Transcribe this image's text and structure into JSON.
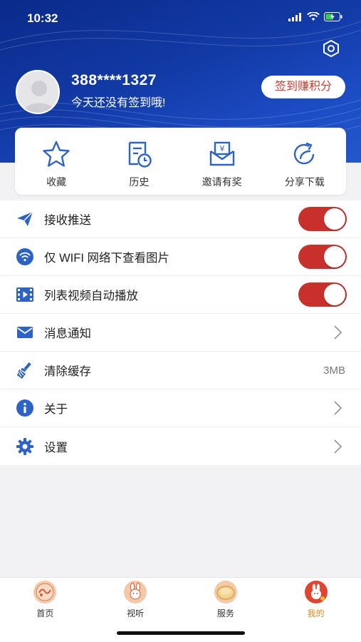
{
  "status_bar": {
    "time": "10:32"
  },
  "profile": {
    "phone": "388****1327",
    "signin_hint": "今天还没有签到哦!",
    "signin_button": "签到赚积分"
  },
  "quick_actions": [
    {
      "label": "收藏",
      "icon": "star-icon"
    },
    {
      "label": "历史",
      "icon": "history-icon"
    },
    {
      "label": "邀请有奖",
      "icon": "invite-reward-icon"
    },
    {
      "label": "分享下载",
      "icon": "share-icon"
    }
  ],
  "settings": [
    {
      "label": "接收推送",
      "icon": "paper-plane-icon",
      "control": "toggle",
      "on": true
    },
    {
      "label": "仅 WIFI 网络下查看图片",
      "icon": "wifi-icon",
      "control": "toggle",
      "on": true
    },
    {
      "label": "列表视频自动播放",
      "icon": "video-icon",
      "control": "toggle",
      "on": true
    },
    {
      "label": "消息通知",
      "icon": "mail-icon",
      "control": "chevron"
    },
    {
      "label": "清除缓存",
      "icon": "broom-icon",
      "control": "value",
      "value": "3MB"
    },
    {
      "label": "关于",
      "icon": "info-icon",
      "control": "chevron"
    },
    {
      "label": "设置",
      "icon": "gear-icon",
      "control": "chevron"
    }
  ],
  "tabs": [
    {
      "label": "首页",
      "active": false
    },
    {
      "label": "视听",
      "active": false
    },
    {
      "label": "服务",
      "active": false
    },
    {
      "label": "我的",
      "active": true
    }
  ],
  "colors": {
    "header_blue": "#123aa6",
    "accent_red": "#c9302c",
    "icon_blue": "#2d63c8",
    "active_tab": "#e58a1a"
  }
}
